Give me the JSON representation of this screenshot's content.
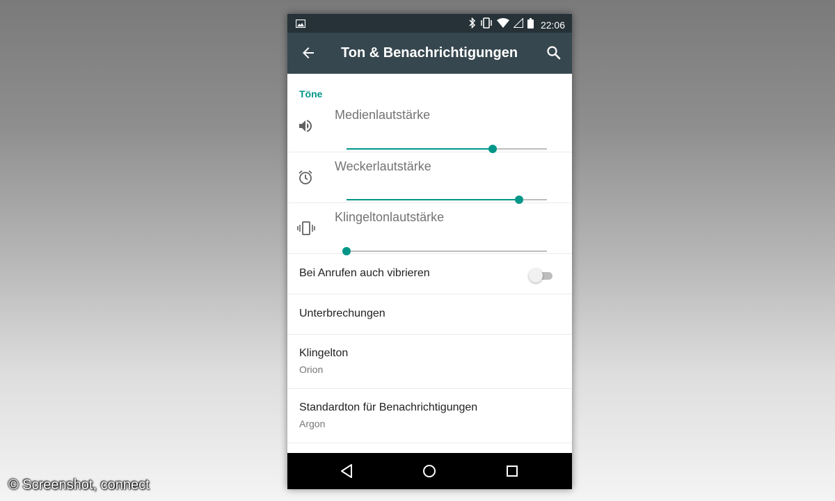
{
  "status_bar": {
    "time": "22:06",
    "icons": [
      "gallery-icon",
      "bluetooth-icon",
      "vibrate-icon",
      "wifi-icon",
      "signal-icon",
      "battery-icon"
    ]
  },
  "toolbar": {
    "title": "Ton & Benachrichtigungen",
    "back_icon": "arrow-back-icon",
    "search_icon": "search-icon"
  },
  "settings": {
    "section_header": "Töne",
    "volumes": [
      {
        "label": "Medienlautstärke",
        "icon": "speaker-icon",
        "level": 0.73
      },
      {
        "label": "Weckerlautstärke",
        "icon": "alarm-clock-icon",
        "level": 0.86
      },
      {
        "label": "Klingeltonlautstärke",
        "icon": "vibrate-icon",
        "level": 0.0
      }
    ],
    "vibrate_on_call": {
      "label": "Bei Anrufen auch vibrieren",
      "enabled": false
    },
    "items": [
      {
        "primary": "Unterbrechungen"
      },
      {
        "primary": "Klingelton",
        "secondary": "Orion"
      },
      {
        "primary": "Standardton für Benachrichtigungen",
        "secondary": "Argon"
      }
    ]
  },
  "nav_bar": {
    "buttons": [
      "back-triangle-icon",
      "home-circle-icon",
      "recents-square-icon"
    ]
  },
  "watermark": "© Screenshot, connect",
  "colors": {
    "accent": "#009688",
    "toolbar": "#37474f",
    "status_bar": "#263238"
  }
}
